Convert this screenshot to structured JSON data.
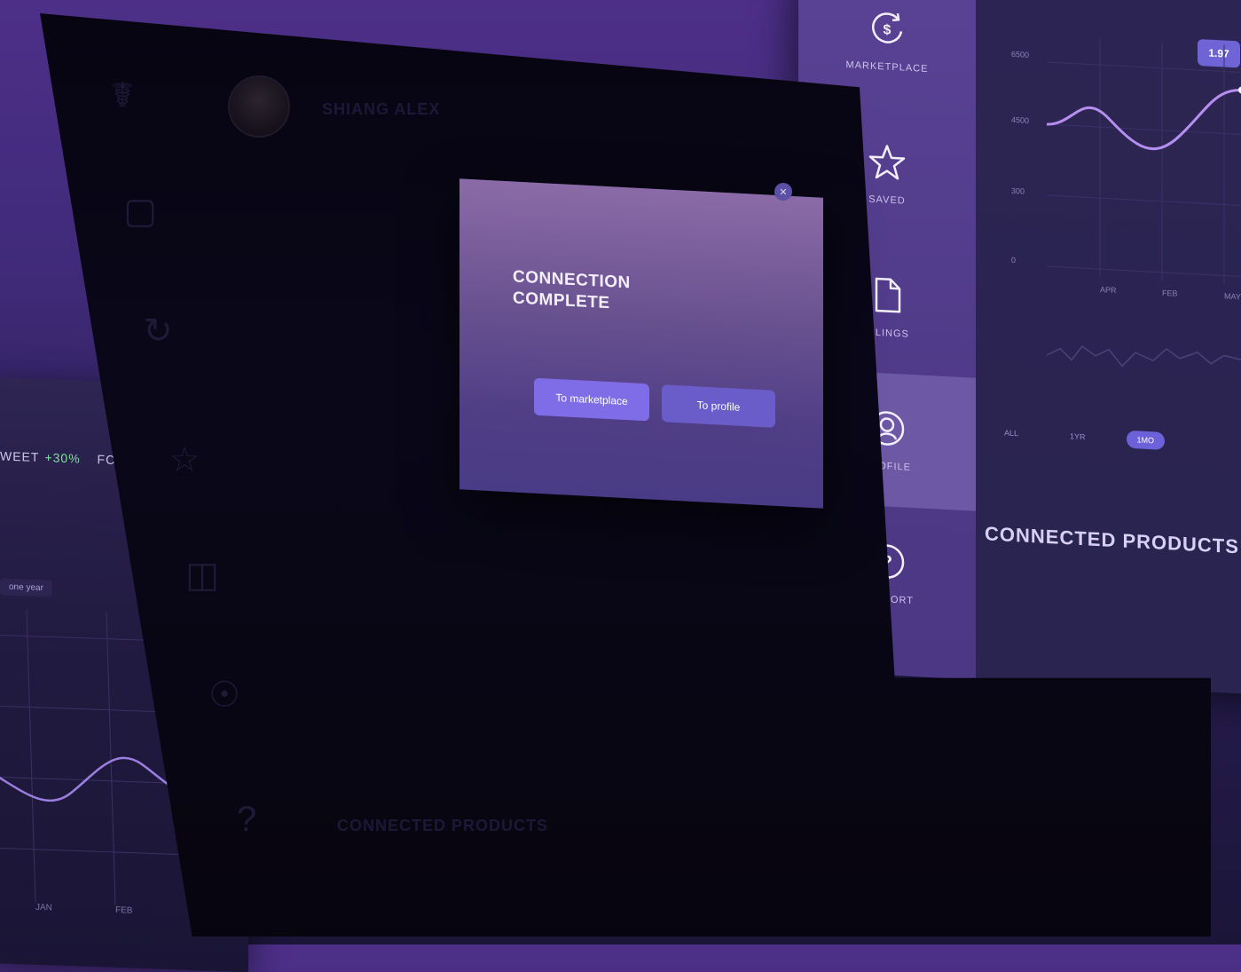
{
  "colors": {
    "accent": "#7f6de8",
    "menu_bg": "#5a4294",
    "menu_active": "#6c58a4",
    "chart_line": "#b58ff0"
  },
  "left_panel": {
    "ticker_symbol": "WEET",
    "ticker_change": "+30%",
    "ticker_extra": "FC",
    "range_label": "one year",
    "x_labels": [
      "JAN",
      "FEB"
    ]
  },
  "main_panel": {
    "user_name": "SHIANG ALEX",
    "connected_heading": "CONNECTED PRODUCTS"
  },
  "modal": {
    "title_line1": "CONNECTION",
    "title_line2": "COMPLETE",
    "button_marketplace": "To marketplace",
    "button_profile": "To profile",
    "close_icon": "close-icon"
  },
  "right_menu": {
    "items": [
      {
        "label": "MARKETPLACE",
        "icon": "dollar-cycle-icon"
      },
      {
        "label": "SAVED",
        "icon": "star-icon"
      },
      {
        "label": "FILINGS",
        "icon": "document-icon"
      },
      {
        "label": "PROFILE",
        "icon": "profile-icon",
        "active": true
      },
      {
        "label": "SUPPORT",
        "icon": "help-icon"
      }
    ]
  },
  "right_chart": {
    "badge": "1.97",
    "y_labels": [
      "6500",
      "4500",
      "300",
      "0"
    ],
    "x_labels": [
      "APR",
      "FEB",
      "MAY"
    ],
    "range_tabs": [
      "ALL",
      "1YR",
      "1MO"
    ],
    "active_tab": "1MO",
    "connected_heading": "CONNECTED PRODUCTS"
  }
}
